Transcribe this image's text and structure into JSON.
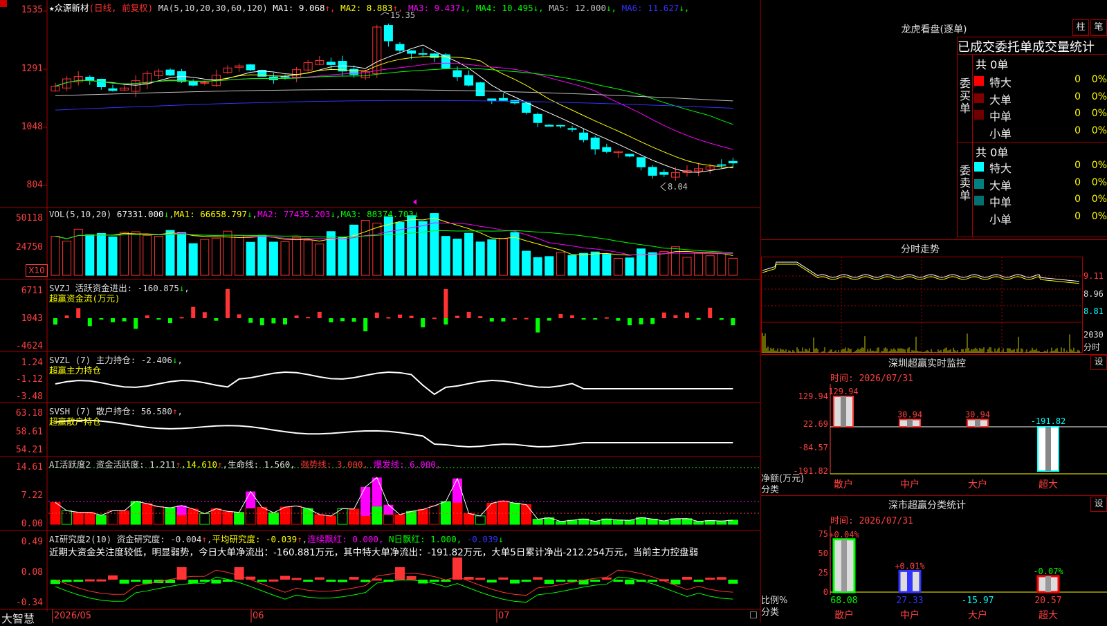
{
  "main": {
    "stock_name": "众源新材",
    "star": "★",
    "adjust": "(日线, 前复权)",
    "ma_title": "MA(5,10,20,30,60,120)",
    "ma_values": [
      {
        "label": "MA1: 9.068",
        "arrow": "↑",
        "color": "#ffffff"
      },
      {
        "label": "MA2: 8.883",
        "arrow": "↑",
        "color": "#ffff00"
      },
      {
        "label": "MA3: 9.437",
        "arrow": "↓",
        "color": "#ff00ff"
      },
      {
        "label": "MA4: 10.495",
        "arrow": "↓",
        "color": "#00ff00"
      },
      {
        "label": "MA5: 12.000",
        "arrow": "↓",
        "color": "#c0c0c0"
      },
      {
        "label": "MA6: 11.627",
        "arrow": "↓",
        "color": "#3333ff"
      }
    ],
    "y_labels": [
      "1535",
      "1291",
      "1048",
      "804"
    ],
    "high_mark": "15.35",
    "low_mark": "8.04",
    "corner_icon": "rect-icon"
  },
  "vol": {
    "title": "VOL(5,10,20)",
    "value": "67331.000",
    "ma1": "MA1: 66658.797",
    "ma2": "MA2: 77435.203",
    "ma3": "MA3: 88374.703",
    "y_labels": [
      "50118",
      "24750"
    ],
    "unit": "X10"
  },
  "svzj": {
    "title": "SVZJ  活跃资金进出: -160.875",
    "subtitle": "超赢资金流(万元)",
    "y_labels": [
      "6711",
      "1043",
      "-4624"
    ]
  },
  "svzl": {
    "title": "SVZL (7) 主力持仓: -2.406",
    "subtitle": "超赢主力持仓",
    "y_labels": [
      "1.24",
      "-1.12",
      "-3.48"
    ]
  },
  "svsh": {
    "title": "SVSH (7) 散户持仓: 56.580",
    "subtitle": "超赢散户持仓",
    "y_labels": [
      "63.18",
      "58.61",
      "54.21"
    ]
  },
  "ai1": {
    "title": "AI活跃度2 资金活跃度: 1.211",
    "v2": "14.610",
    "life": "生命线: 1.560,",
    "strong": "强势线: 3.000,",
    "burst": "爆发线: 6.000,",
    "y_labels": [
      "14.61",
      "7.22",
      "0.00"
    ]
  },
  "ai2": {
    "title": "AI研究度2(10) 资金研究度: -0.004",
    "avg": "平均研究度: -0.039",
    "red": "连续飘红: 0.000,",
    "nred": "N日飘红: 1.000,",
    "last": "-0.039",
    "commentary": "近期大资金关注度较低，明显弱势，今日大单净流出：-160.881万元，其中特大单净流出：-191.82万元，大单5日累计净出-212.254万元，当前主力控盘弱",
    "y_labels": [
      "0.49",
      "0.08",
      "-0.34"
    ]
  },
  "xaxis": {
    "brand": "大智慧",
    "dates": [
      "2026/05",
      "06",
      "07"
    ]
  },
  "lhb": {
    "title": "龙虎看盘(逐单)",
    "btn_bar": "柱",
    "btn_pen": "笔",
    "tabs": "已成交委托单成交量统计",
    "buy_label": "委买单",
    "sell_label": "委卖单",
    "buy_total": "共 0单",
    "sell_total": "共 0单",
    "buy_rows": [
      {
        "name": "特大",
        "v": "0",
        "p": "0%",
        "color": "#ff0000"
      },
      {
        "name": "大单",
        "v": "0",
        "p": "0%",
        "color": "#800000"
      },
      {
        "name": "中单",
        "v": "0",
        "p": "0%",
        "color": "#700000"
      },
      {
        "name": "小单",
        "v": "0",
        "p": "0%",
        "color": "#000000"
      }
    ],
    "sell_rows": [
      {
        "name": "特大",
        "v": "0",
        "p": "0%",
        "color": "#00ffff"
      },
      {
        "name": "大单",
        "v": "0",
        "p": "0%",
        "color": "#008080"
      },
      {
        "name": "中单",
        "v": "0",
        "p": "0%",
        "color": "#007070"
      },
      {
        "name": "小单",
        "v": "0",
        "p": "0%",
        "color": "#000000"
      }
    ]
  },
  "fenshi": {
    "title": "分时走势",
    "y_labels": [
      "9.11",
      "8.96",
      "8.81"
    ],
    "vol_label": "2030",
    "vol_unit": "分时"
  },
  "sz_monitor": {
    "title": "深圳超赢实时监控",
    "btn": "设",
    "time": "时间: 2026/07/31",
    "y_labels": [
      "129.94",
      "22.69",
      "-84.57",
      "-191.82"
    ],
    "axis_unit": "净额(万元)",
    "axis_cat": "分类",
    "categories": [
      "散户",
      "中户",
      "大户",
      "超大"
    ],
    "values": [
      129.94,
      30.94,
      30.94,
      -191.82
    ],
    "value_labels": [
      "129.94",
      "30.94",
      "30.94",
      "-191.82"
    ]
  },
  "sz_class": {
    "title": "深市超赢分类统计",
    "btn": "设",
    "time": "时间: 2026/07/31",
    "y_labels": [
      "75",
      "50",
      "25",
      "0"
    ],
    "axis_unit": "比例%",
    "axis_cat": "分类",
    "categories": [
      "散户",
      "中户",
      "大户",
      "超大"
    ],
    "ratio": [
      68.08,
      27.33,
      -15.97,
      20.57
    ],
    "ratio_labels": [
      "68.08",
      "27.33",
      "-15.97",
      "20.57"
    ],
    "change_labels": [
      "+0.04%",
      "+0.01%",
      "",
      "-0.07%"
    ]
  },
  "colors": {
    "up": "#ff3333",
    "down": "#00ffff",
    "frame": "#aa0000"
  }
}
